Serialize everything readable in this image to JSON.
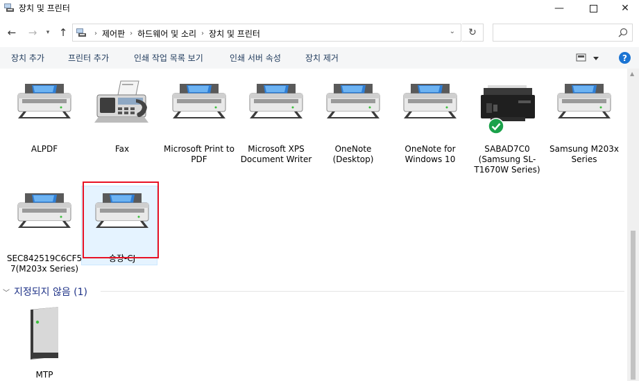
{
  "window": {
    "title": "장치 및 프린터"
  },
  "address": {
    "crumbs": [
      "제어판",
      "하드웨어 및 소리",
      "장치 및 프린터"
    ],
    "search_placeholder": ""
  },
  "commands": {
    "add_device": "장치 추가",
    "add_printer": "프린터 추가",
    "see_queue": "인쇄 작업 목록 보기",
    "server_props": "인쇄 서버 속성",
    "remove_device": "장치 제거"
  },
  "printers": [
    {
      "label": "ALPDF",
      "icon": "printer-icon"
    },
    {
      "label": "Fax",
      "icon": "fax-icon"
    },
    {
      "label": "Microsoft Print to PDF",
      "icon": "printer-icon"
    },
    {
      "label": "Microsoft XPS Document Writer",
      "icon": "printer-icon"
    },
    {
      "label": "OneNote (Desktop)",
      "icon": "printer-icon"
    },
    {
      "label": "OneNote for Windows 10",
      "icon": "printer-icon"
    },
    {
      "label": "SABAD7C0 (Samsung SL-T1670W Series)",
      "icon": "inkjet-printer-icon",
      "default": true
    },
    {
      "label": "Samsung M203x Series",
      "icon": "printer-icon"
    },
    {
      "label": "SEC842519C6CF57(M203x Series)",
      "icon": "printer-icon"
    },
    {
      "label": "송장-CJ",
      "icon": "printer-icon",
      "selected": true
    }
  ],
  "unspecified": {
    "header": "지정되지 않음 (1)",
    "devices": [
      {
        "label": "MTP",
        "icon": "tower-device-icon"
      }
    ]
  },
  "colors": {
    "accent": "#1b74d3",
    "command_text": "#1e395b",
    "group_header": "#1e3287",
    "highlight_box": "#e81123",
    "default_check": "#1aa14a"
  }
}
